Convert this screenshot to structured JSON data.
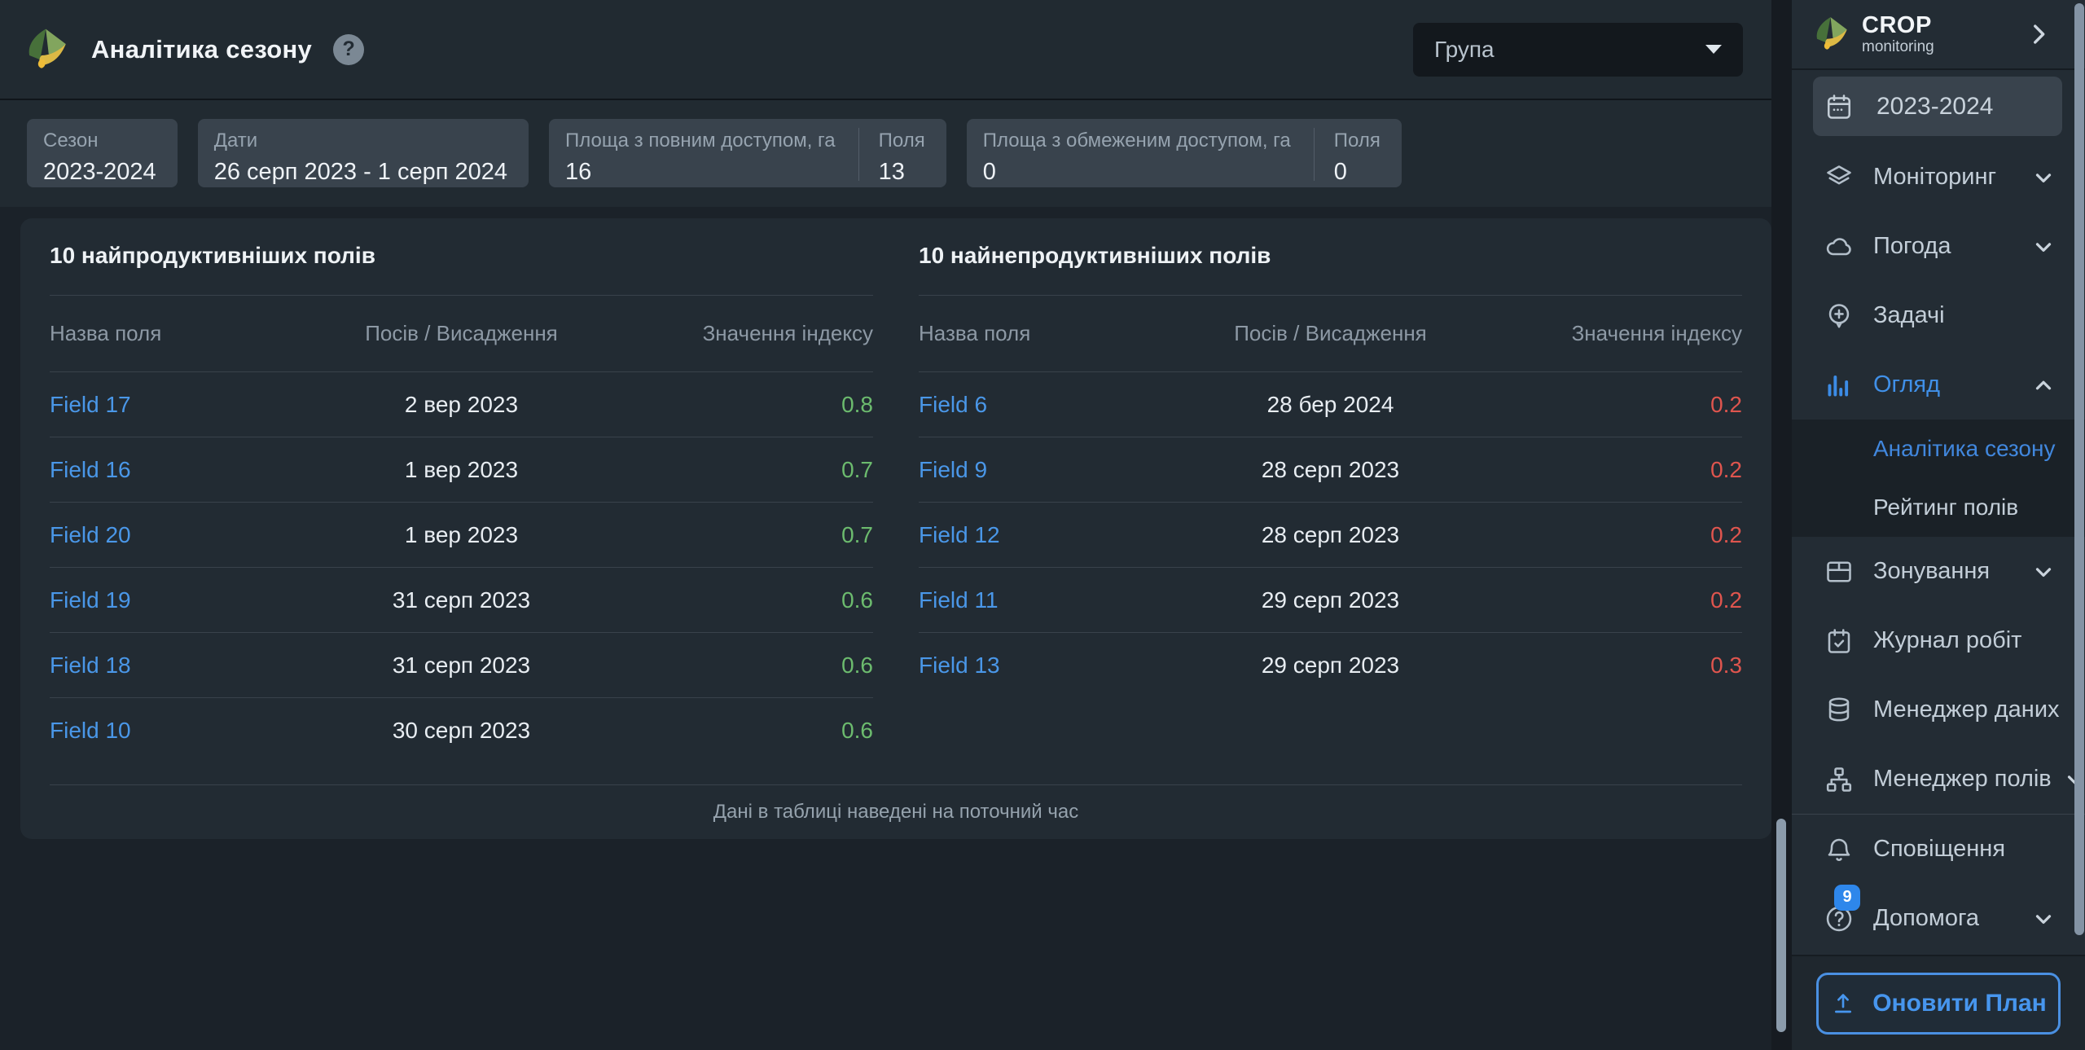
{
  "header": {
    "title": "Аналітика сезону",
    "help_badge": "?",
    "group_dropdown_label": "Група"
  },
  "stats": {
    "season": {
      "label": "Сезон",
      "value": "2023-2024"
    },
    "dates": {
      "label": "Дати",
      "value": "26 серп 2023 - 1 серп 2024"
    },
    "full_access": {
      "label": "Площа з повним доступом, га",
      "value": "16",
      "fields_label": "Поля",
      "fields_value": "13"
    },
    "limited_access": {
      "label": "Площа з обмеженим доступом, га",
      "value": "0",
      "fields_label": "Поля",
      "fields_value": "0"
    }
  },
  "tables": {
    "columns": {
      "name": "Назва поля",
      "sowing": "Посів / Висадження",
      "index": "Значення індексу"
    },
    "most_productive": {
      "title": "10 найпродуктивніших полів",
      "rows": [
        {
          "field": "Field 17",
          "date": "2 вер 2023",
          "index": "0.8"
        },
        {
          "field": "Field 16",
          "date": "1 вер 2023",
          "index": "0.7"
        },
        {
          "field": "Field 20",
          "date": "1 вер 2023",
          "index": "0.7"
        },
        {
          "field": "Field 19",
          "date": "31 серп 2023",
          "index": "0.6"
        },
        {
          "field": "Field 18",
          "date": "31 серп 2023",
          "index": "0.6"
        },
        {
          "field": "Field 10",
          "date": "30 серп 2023",
          "index": "0.6"
        }
      ]
    },
    "least_productive": {
      "title": "10 найнепродуктивніших полів",
      "rows": [
        {
          "field": "Field 6",
          "date": "28 бер 2024",
          "index": "0.2"
        },
        {
          "field": "Field 9",
          "date": "28 серп 2023",
          "index": "0.2"
        },
        {
          "field": "Field 12",
          "date": "28 серп 2023",
          "index": "0.2"
        },
        {
          "field": "Field 11",
          "date": "29 серп 2023",
          "index": "0.2"
        },
        {
          "field": "Field 13",
          "date": "29 серп 2023",
          "index": "0.3"
        }
      ]
    },
    "footer_note": "Дані в таблиці наведені на поточний час"
  },
  "sidebar": {
    "brand": {
      "name": "CROP",
      "subtitle": "monitoring"
    },
    "season": "2023-2024",
    "items": [
      {
        "label": "Моніторинг"
      },
      {
        "label": "Погода"
      },
      {
        "label": "Задачі"
      },
      {
        "label": "Огляд"
      },
      {
        "label": "Зонування"
      },
      {
        "label": "Журнал робіт"
      },
      {
        "label": "Менеджер даних"
      },
      {
        "label": "Менеджер полів"
      },
      {
        "label": "Сповіщення"
      },
      {
        "label": "Допомога",
        "badge": "9"
      }
    ],
    "submenu": [
      {
        "label": "Аналітика сезону"
      },
      {
        "label": "Рейтинг полів"
      }
    ],
    "update_plan": "Оновити План"
  },
  "colors": {
    "accent_blue": "#4090e8",
    "link_blue": "#4a97e8",
    "positive_green": "#6cbb6e",
    "negative_red": "#df554e",
    "scrollbar": "#8b9bab"
  }
}
